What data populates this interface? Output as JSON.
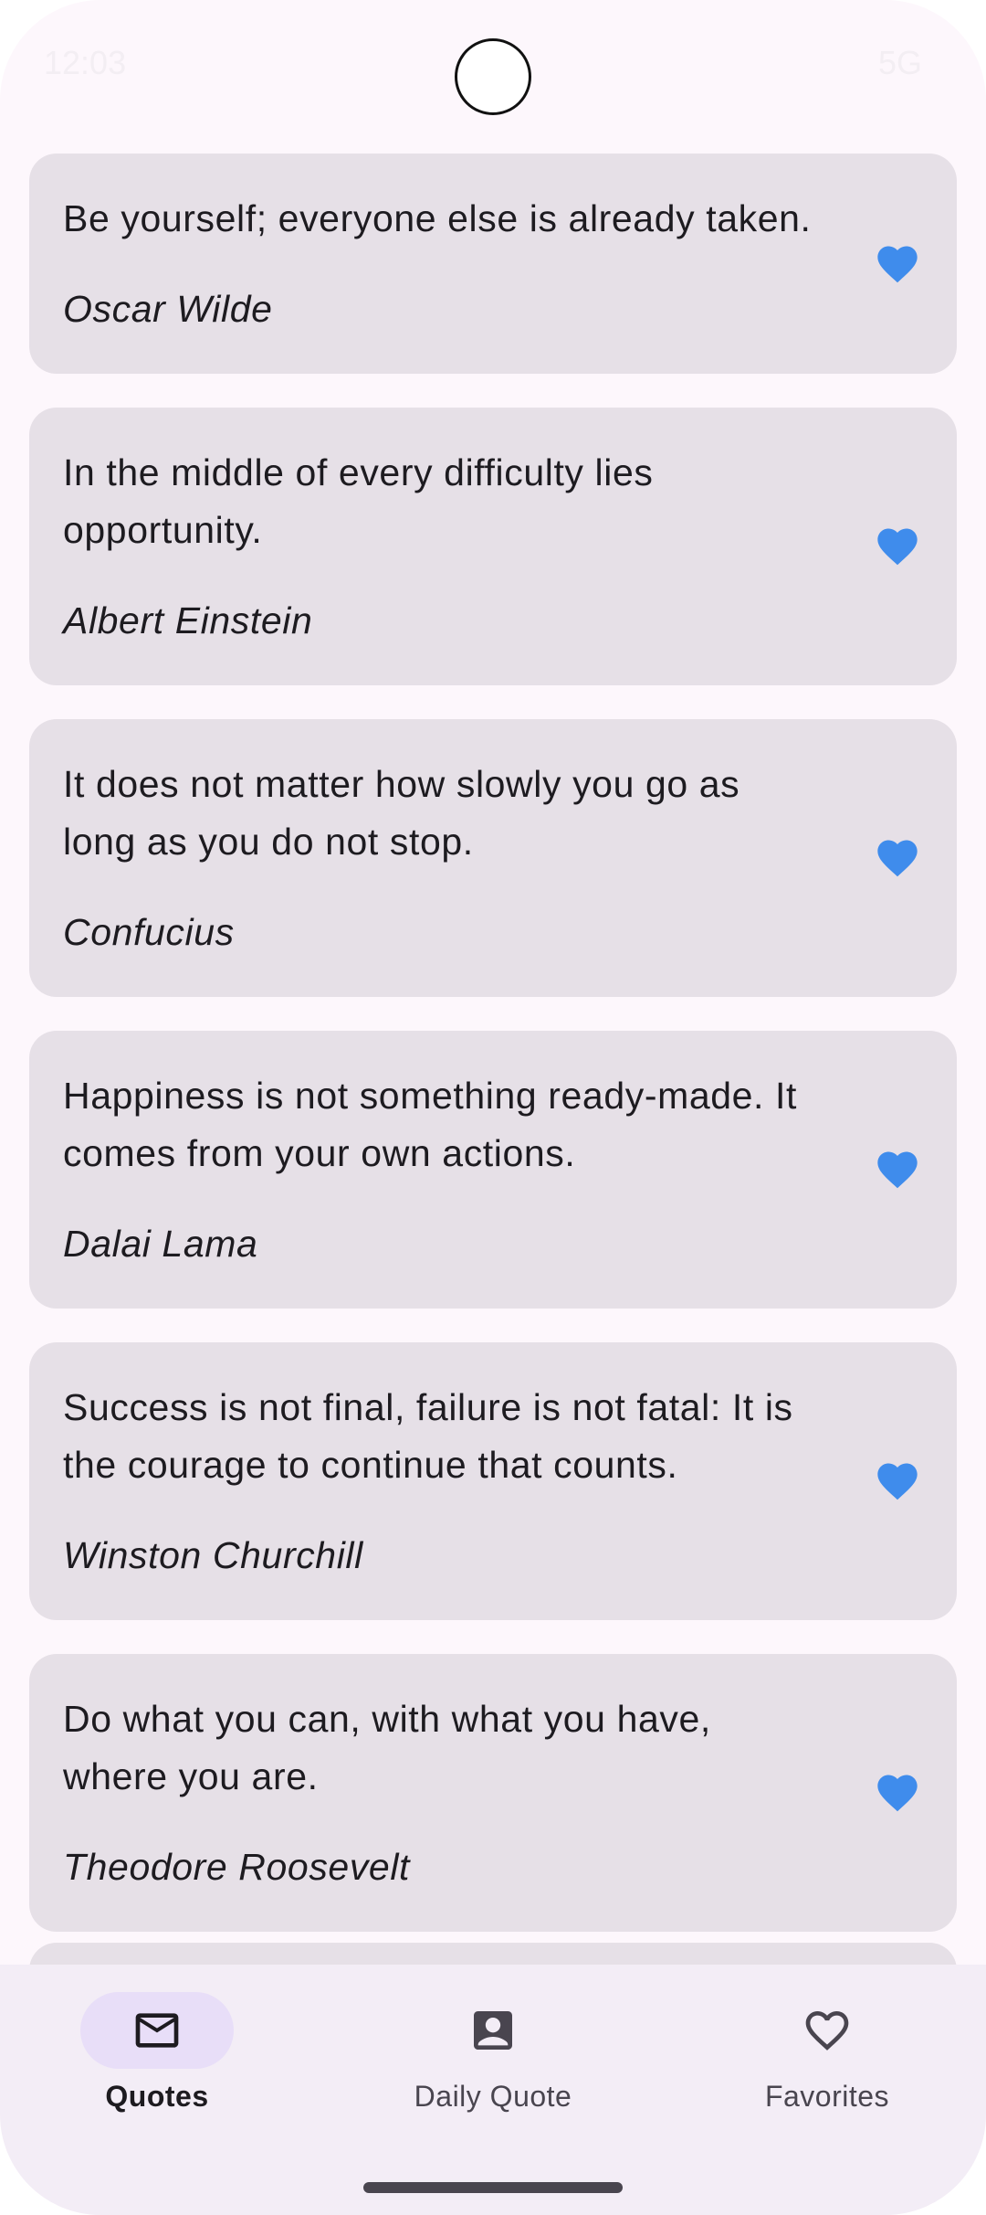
{
  "status_bar": {
    "time": "12:03",
    "network": "5G"
  },
  "quotes": [
    {
      "text": "Be yourself; everyone else is already taken.",
      "author": "Oscar Wilde",
      "favorite": true
    },
    {
      "text": "In the middle of every difficulty lies opportunity.",
      "author": "Albert Einstein",
      "favorite": true
    },
    {
      "text": "It does not matter how slowly you go as long as you do not stop.",
      "author": "Confucius",
      "favorite": true
    },
    {
      "text": "Happiness is not something ready-made. It comes from your own actions.",
      "author": "Dalai Lama",
      "favorite": true
    },
    {
      "text": "Success is not final, failure is not fatal: It is the courage to continue that counts.",
      "author": "Winston Churchill",
      "favorite": true
    },
    {
      "text": "Do what you can, with what you have, where you are.",
      "author": "Theodore Roosevelt",
      "favorite": true
    }
  ],
  "nav": {
    "items": [
      {
        "label": "Quotes",
        "icon": "mail-icon",
        "active": true
      },
      {
        "label": "Daily Quote",
        "icon": "contact-card-icon",
        "active": false
      },
      {
        "label": "Favorites",
        "icon": "heart-outline-icon",
        "active": false
      }
    ]
  },
  "colors": {
    "background": "#fdf7fc",
    "card": "#e6e0e7",
    "favorite_heart": "#3f8cec",
    "nav_background": "#f3edf6",
    "nav_active_indicator": "#e8def8"
  }
}
